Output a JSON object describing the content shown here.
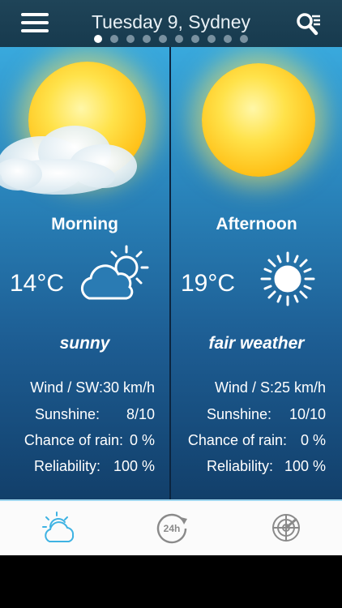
{
  "header": {
    "title": "Tuesday 9, Sydney",
    "page_count": 10,
    "active_page": 0
  },
  "panels": [
    {
      "period": "Morning",
      "temperature": "14°C",
      "condition": "sunny",
      "icon": "sun-cloud-icon",
      "wind_label": "Wind / SW:30 km/h",
      "sunshine_label": "Sunshine:",
      "sunshine_value": "8/10",
      "rain_label": "Chance of rain:",
      "rain_value": "0 %",
      "reliability_label": "Reliability:",
      "reliability_value": "100 %"
    },
    {
      "period": "Afternoon",
      "temperature": "19°C",
      "condition": "fair weather",
      "icon": "sun-icon",
      "wind_label": "Wind / S:25 km/h",
      "sunshine_label": "Sunshine:",
      "sunshine_value": "10/10",
      "rain_label": "Chance of rain:",
      "rain_value": "0 %",
      "reliability_label": "Reliability:",
      "reliability_value": "100 %"
    }
  ],
  "tabbar": {
    "active": "forecast",
    "accent": "#3fb3e3",
    "inactive_color": "#8a8a8a",
    "tabs": [
      "forecast-tab",
      "24h-tab",
      "radar-tab"
    ]
  }
}
